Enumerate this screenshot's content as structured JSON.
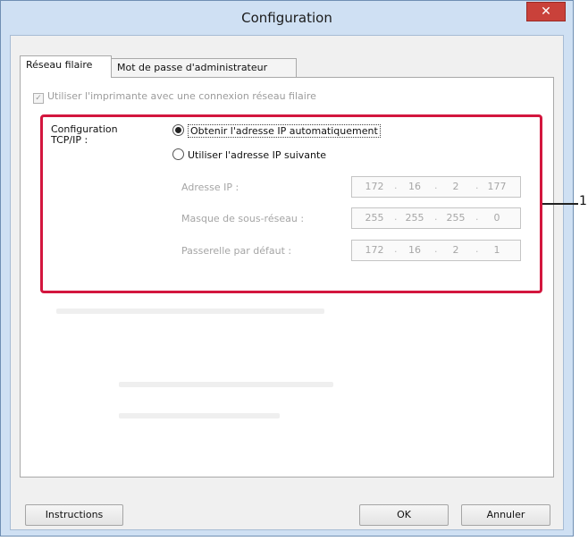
{
  "window": {
    "title": "Configuration",
    "close_glyph": "✕"
  },
  "tabs": [
    {
      "label": "Réseau filaire",
      "active": true
    },
    {
      "label": "Mot de passe d'administrateur",
      "active": false
    }
  ],
  "wired": {
    "checkbox_label": "Utiliser l'imprimante avec une connexion réseau filaire",
    "checked": true,
    "tcpip_label": "Configuration TCP/IP :",
    "radio_auto": "Obtenir l'adresse IP automatiquement",
    "radio_manual": "Utiliser l'adresse IP suivante",
    "selected": "auto",
    "fields": [
      {
        "label": "Adresse IP :",
        "octets": [
          "172",
          "16",
          "2",
          "177"
        ]
      },
      {
        "label": "Masque de sous-réseau :",
        "octets": [
          "255",
          "255",
          "255",
          "0"
        ]
      },
      {
        "label": "Passerelle par défaut :",
        "octets": [
          "172",
          "16",
          "2",
          "1"
        ]
      }
    ]
  },
  "callout": {
    "number": "1"
  },
  "buttons": {
    "instructions": "Instructions",
    "ok": "OK",
    "cancel": "Annuler"
  }
}
